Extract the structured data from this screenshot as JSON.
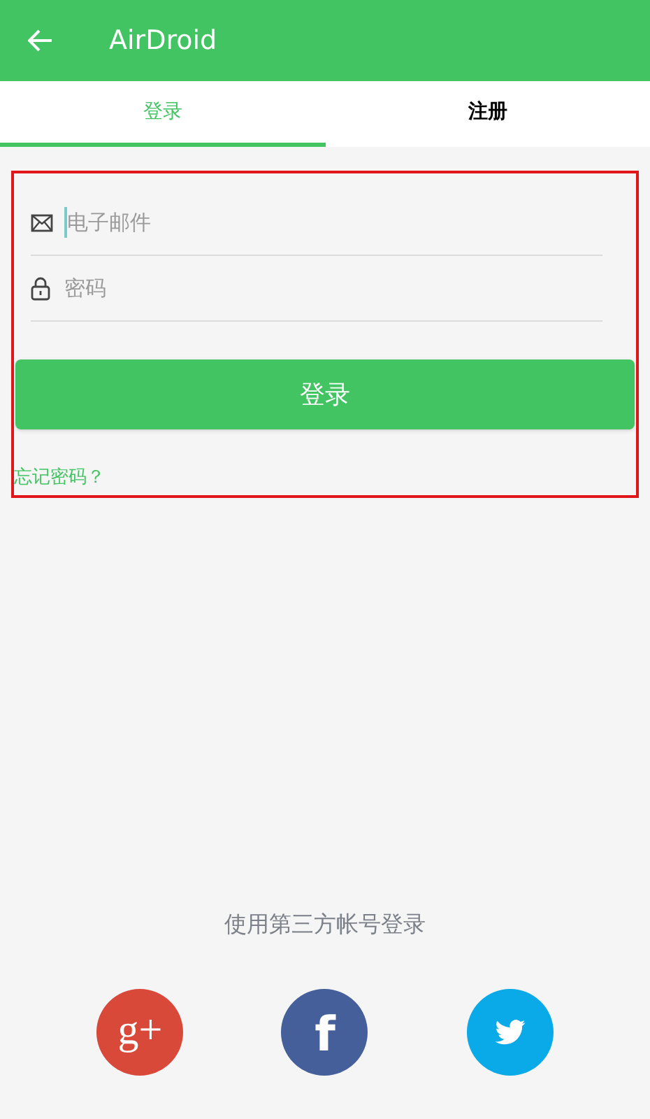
{
  "app_bar": {
    "title": "AirDroid"
  },
  "tabs": [
    {
      "label": "登录",
      "selected": true
    },
    {
      "label": "注册",
      "selected": false
    }
  ],
  "form": {
    "fields": [
      {
        "kind": "email",
        "placeholder": "电子邮件",
        "focused": true
      },
      {
        "kind": "password",
        "placeholder": "密码",
        "focused": false
      }
    ],
    "submit": "登录",
    "forgot": "忘记密码？"
  },
  "social": {
    "caption": "使用第三方帐号登录",
    "buttons": [
      {
        "kind": "google",
        "label": "g+",
        "color": "#d9493a"
      },
      {
        "kind": "facebook",
        "label": "f",
        "color": "#445f9a"
      },
      {
        "kind": "twitter",
        "color": "#0aa9e8"
      }
    ]
  }
}
